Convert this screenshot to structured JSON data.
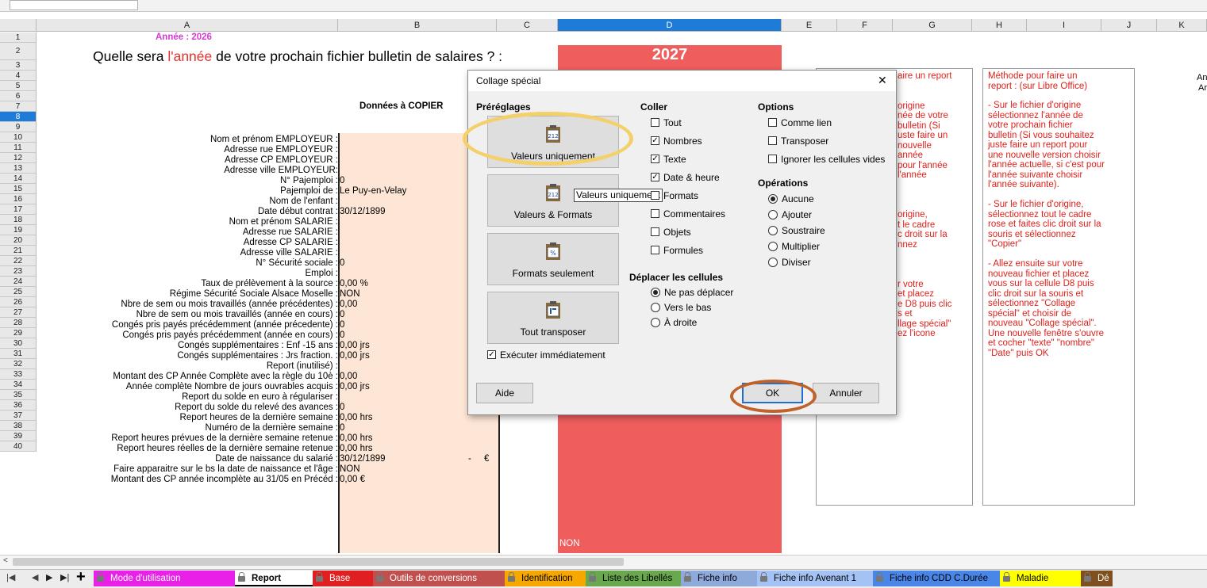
{
  "columns": [
    "A",
    "B",
    "C",
    "D",
    "E",
    "F",
    "G",
    "H",
    "I",
    "J",
    "K"
  ],
  "rows": [
    "1",
    "2",
    "3",
    "4",
    "5",
    "6",
    "7",
    "8",
    "9",
    "10",
    "11",
    "12",
    "13",
    "14",
    "15",
    "16",
    "17",
    "18",
    "19",
    "20",
    "21",
    "22",
    "23",
    "24",
    "25",
    "26",
    "27",
    "28",
    "29",
    "30",
    "31",
    "32",
    "33",
    "34",
    "35",
    "36",
    "37",
    "38",
    "39",
    "40"
  ],
  "sheet": {
    "annee": "Année : 2026",
    "question_pre": "Quelle sera ",
    "question_red": "l'année",
    "question_post": " de votre prochain fichier  bulletin de salaires ? :",
    "year_value": "2027",
    "donnees": "Données à COPIER",
    "labels": [
      "Nom et prénom EMPLOYEUR :",
      "Adresse rue EMPLOYEUR :",
      "Adresse CP EMPLOYEUR :",
      "Adresse ville EMPLOYEUR:",
      "N° Pajemploi :",
      "Pajemploi de :",
      "Nom de l'enfant :",
      "Date début contrat :",
      "Nom et prénom SALARIE :",
      "Adresse rue SALARIE :",
      "Adresse CP SALARIE :",
      "Adresse ville SALARIE :",
      "N° Sécurité sociale :",
      "Emploi :",
      "Taux de prélèvement à la source :",
      "Régime Sécurité Sociale Alsace Moselle :",
      "Nbre de sem ou mois travaillés (année précédentes) :",
      "Nbre de sem ou mois travaillés (année en cours) :",
      "Congés pris payés précédemment (année précedente) :",
      "Congés pris payés précédemment (année en cours) :",
      "Congés supplémentaires : Enf -15 ans :",
      "Congés supplémentaires : Jrs fraction. :",
      "Report (inutilisé) :",
      "Montant des CP Année Complète avec la règle du 10è :",
      "Année complète Nombre de jours ouvrables acquis :",
      "Report du solde en euro à régulariser :",
      "Report du solde du relevé des avances :",
      "Report heures de la dernière semaine :",
      "Numéro de la dernière semaine :",
      "Report heures prévues de la dernière semaine retenue :",
      "Report heures réelles de la dernière semaine retenue :",
      "Date de naissance du salarié :",
      "Faire apparaitre sur le bs la date de naissance et l'âge :",
      "Montant des CP année incomplète au 31/05 en  Précéd :"
    ],
    "values": [
      "",
      "",
      "",
      "",
      "0",
      "Le Puy-en-Velay",
      "",
      "30/12/1899",
      "",
      "",
      "",
      "",
      "0",
      "",
      "0,00 %",
      "NON",
      "0,00",
      "0",
      "0",
      "0",
      "0,00 jrs",
      "0,00 jrs",
      "",
      "0,00",
      "0,00 jrs",
      "",
      "0",
      "0,00 hrs",
      "0",
      "0,00 hrs",
      "0,00 hrs",
      "30/12/1899",
      "NON",
      "0,00 €"
    ],
    "euro_dash": "-",
    "euro_sign": "€",
    "d_non": "NON",
    "k_text1": "An",
    "k_text2": "Ar"
  },
  "notes": {
    "g_text": "aire un report\n\n\norigine\nnée de votre\nbulletin (Si\nuste faire un\nnouvelle\nannée\npour l'année\nl'année\n\n\n\norigine,\nt le cadre\nc droit sur la\nnnez\n\n\n\nr votre\net placez\ne D8 puis clic\ns et\nllage spécial\"\nez l'icone",
    "j_title": "Méthode pour faire un\nreport : (sur Libre Office)",
    "j_body": "- Sur le fichier d'origine\nsélectionnez l'année de\nvotre prochain fichier\nbulletin (Si vous souhaitez\njuste faire un report pour\nune nouvelle version choisir\nl'année actuelle, si c'est pour\nl'année suivante choisir\nl'année suivante).\n\n- Sur le fichier d'origine,\nsélectionnez tout le cadre\nrose et faites clic droit sur la\nsouris et sélectionnez\n\"Copier\"\n\n- Allez ensuite sur votre\nnouveau fichier et placez\nvous sur la cellule D8 puis\nclic droit sur la souris et\nsélectionnez \"Collage\nspécial\" et choisir de\nnouveau \"Collage spécial\".\nUne nouvelle fenêtre s'ouvre\net cocher \"texte\" \"nombre\"\n\"Date\" puis OK"
  },
  "dialog": {
    "title": "Collage spécial",
    "presets_header": "Préréglages",
    "presets": [
      "Valeurs uniquement",
      "Valeurs & Formats",
      "Formats seulement",
      "Tout transposer"
    ],
    "execute_label": "Exécuter immédiatement",
    "execute_checked": true,
    "tooltip": "Valeurs uniquement",
    "paste_header": "Coller",
    "paste_items": [
      {
        "label": "Tout",
        "checked": false
      },
      {
        "label": "Nombres",
        "checked": true
      },
      {
        "label": "Texte",
        "checked": true
      },
      {
        "label": "Date & heure",
        "checked": true
      },
      {
        "label": "Formats",
        "checked": false
      },
      {
        "label": "Commentaires",
        "checked": false
      },
      {
        "label": "Objets",
        "checked": false
      },
      {
        "label": "Formules",
        "checked": false
      }
    ],
    "move_header": "Déplacer les cellules",
    "move_items": [
      "Ne pas déplacer",
      "Vers le bas",
      "À droite"
    ],
    "move_selected": "Ne pas déplacer",
    "options_header": "Options",
    "options_items": [
      "Comme lien",
      "Transposer",
      "Ignorer les cellules vides"
    ],
    "operations_header": "Opérations",
    "operations_items": [
      "Aucune",
      "Ajouter",
      "Soustraire",
      "Multiplier",
      "Diviser"
    ],
    "operation_selected": "Aucune",
    "help_label": "Aide",
    "ok_label": "OK",
    "cancel_label": "Annuler",
    "close_glyph": "✕"
  },
  "tabs": [
    {
      "label": "Mode d'utilisation",
      "color": "#e820e8",
      "text_color": "#ffffff"
    },
    {
      "label": "Report",
      "color": "#ffffff",
      "text_color": "#000000",
      "active": true
    },
    {
      "label": "Base",
      "color": "#e02020",
      "text_color": "#ffffff"
    },
    {
      "label": "Outils de conversions",
      "color": "#c0504d",
      "text_color": "#ffffff"
    },
    {
      "label": "Identification",
      "color": "#f7a800",
      "text_color": "#000000"
    },
    {
      "label": "Liste des Libellés",
      "color": "#6aa84f",
      "text_color": "#000000"
    },
    {
      "label": "Fiche info",
      "color": "#8eaadb",
      "text_color": "#000000"
    },
    {
      "label": "Fiche info Avenant 1",
      "color": "#a4c2f4",
      "text_color": "#000000"
    },
    {
      "label": "Fiche info CDD C.Durée",
      "color": "#4a86e8",
      "text_color": "#000000"
    },
    {
      "label": "Maladie",
      "color": "#ffff00",
      "text_color": "#000000"
    },
    {
      "label": "Dé",
      "color": "#7f4f1f",
      "text_color": "#ffffff"
    }
  ],
  "colors": {
    "pink_fill": "#fde6d6",
    "red_fill": "#f05d5d",
    "highlight_yellow": "#f3d06a",
    "highlight_brown": "#c0622a"
  }
}
